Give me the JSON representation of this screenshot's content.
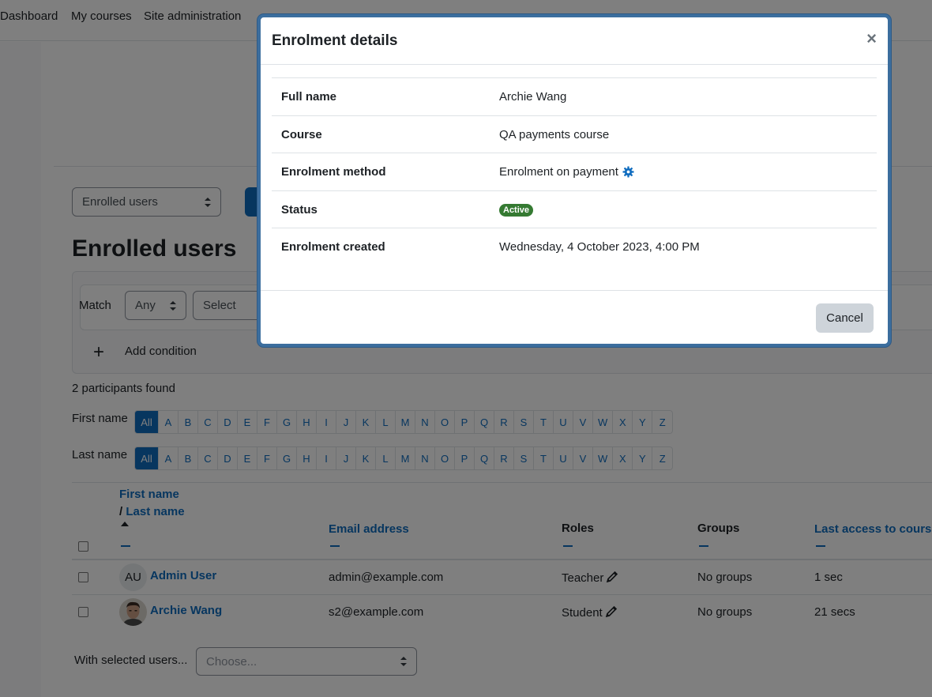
{
  "nav": {
    "items": [
      "Dashboard",
      "My courses",
      "Site administration"
    ]
  },
  "toolbar": {
    "page_select_value": "Enrolled users"
  },
  "page": {
    "title": "Enrolled users"
  },
  "filter": {
    "match_label": "Match",
    "match_value": "Any",
    "type_placeholder": "Select",
    "add_condition_label": "Add condition"
  },
  "participants_found": "2 participants found",
  "initials": {
    "first_label": "First name",
    "last_label": "Last name",
    "letters": [
      "All",
      "A",
      "B",
      "C",
      "D",
      "E",
      "F",
      "G",
      "H",
      "I",
      "J",
      "K",
      "L",
      "M",
      "N",
      "O",
      "P",
      "Q",
      "R",
      "S",
      "T",
      "U",
      "V",
      "W",
      "X",
      "Y",
      "Z"
    ]
  },
  "table": {
    "col_first": "First name",
    "col_sep": "/ ",
    "col_last": "Last name",
    "col_email": "Email address",
    "col_roles": "Roles",
    "col_groups": "Groups",
    "col_access": "Last access to course",
    "rows": [
      {
        "initials": "AU",
        "name": "Admin User",
        "email": "admin@example.com",
        "role": "Teacher",
        "groups": "No groups",
        "access": "1 sec"
      },
      {
        "initials": "",
        "name": "Archie Wang",
        "email": "s2@example.com",
        "role": "Student",
        "groups": "No groups",
        "access": "21 secs"
      }
    ]
  },
  "bulk": {
    "label": "With selected users...",
    "placeholder": "Choose..."
  },
  "modal": {
    "title": "Enrolment details",
    "close_symbol": "×",
    "rows": [
      {
        "label": "Full name",
        "value": "Archie Wang"
      },
      {
        "label": "Course",
        "value": "QA payments course"
      },
      {
        "label": "Enrolment method",
        "value": "Enrolment on payment"
      },
      {
        "label": "Status",
        "value": "Active"
      },
      {
        "label": "Enrolment created",
        "value": "Wednesday, 4 October 2023, 4:00 PM"
      }
    ],
    "cancel_label": "Cancel"
  },
  "colors": {
    "link": "#0f6cbf",
    "active_badge": "#357a32",
    "modal_border": "#3c6e9e"
  },
  "icons": [
    "gear-icon",
    "pencil-icon",
    "close-icon",
    "plus-icon",
    "sort-caret-icon"
  ]
}
